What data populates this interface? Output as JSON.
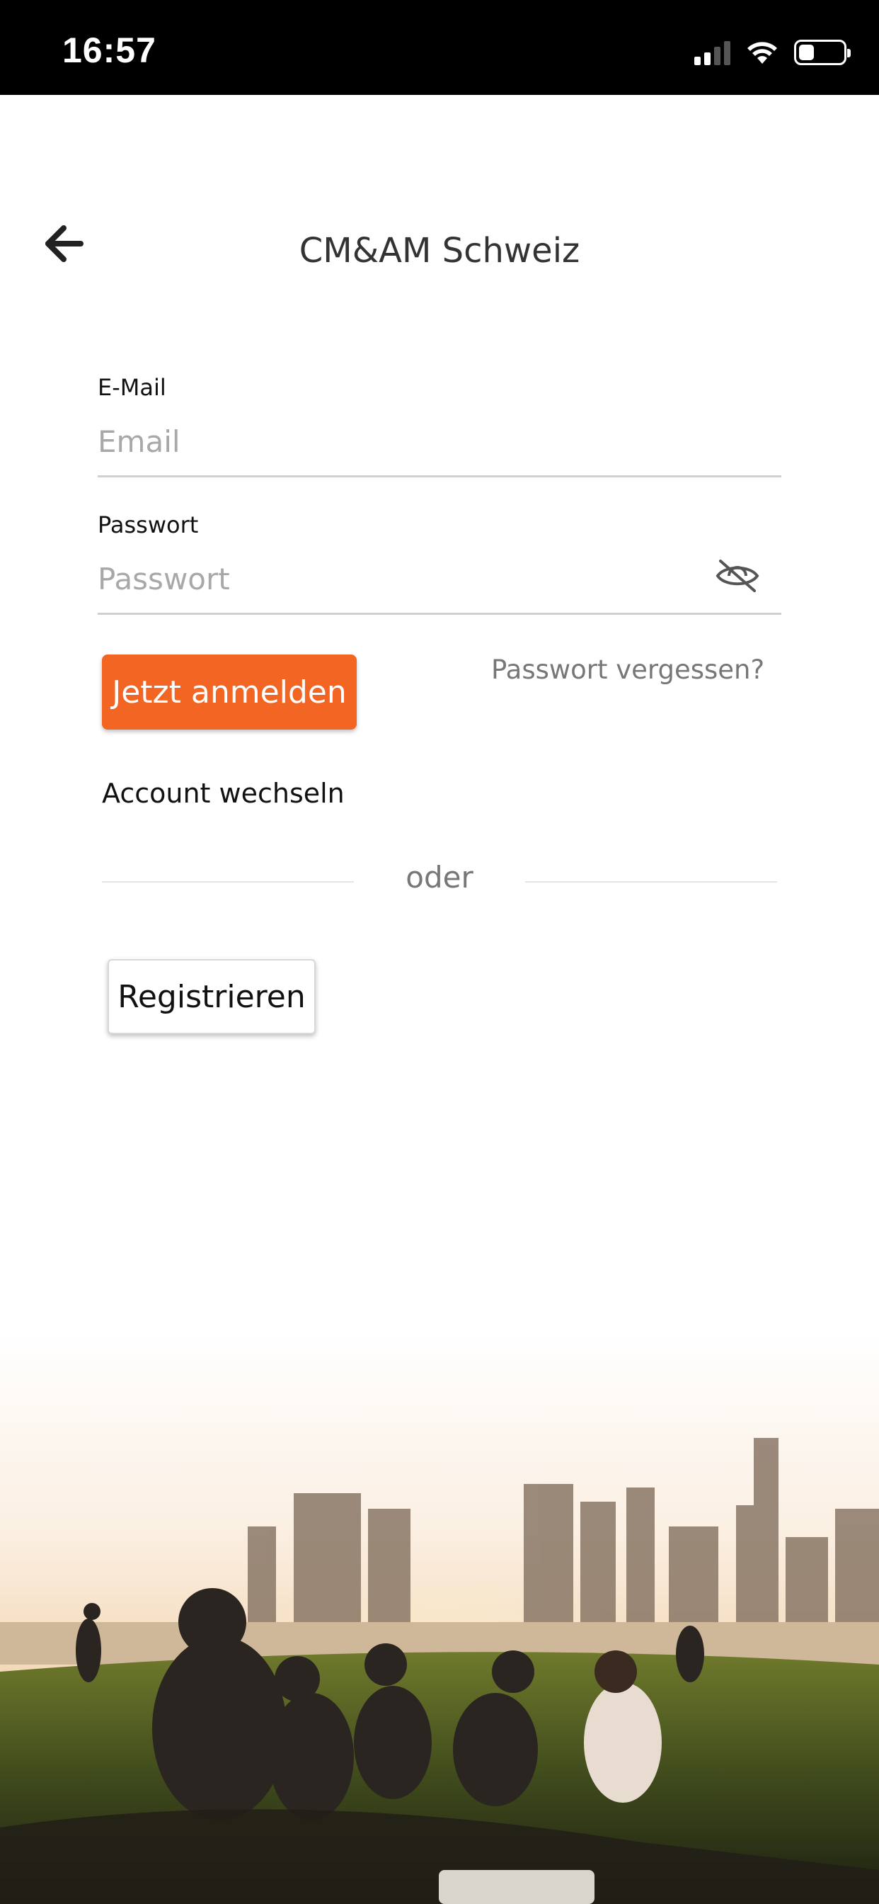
{
  "status_bar": {
    "time": "16:57",
    "signal_icon": "cellular-signal-icon",
    "wifi_icon": "wifi-icon",
    "battery_icon": "battery-icon",
    "battery_level_percent": 35
  },
  "header": {
    "back_icon": "arrow-left-icon",
    "title": "CM&AM Schweiz"
  },
  "form": {
    "email_label": "E-Mail",
    "email_placeholder": "Email",
    "email_value": "",
    "password_label": "Passwort",
    "password_placeholder": "Passwort",
    "password_value": "",
    "password_visibility_icon": "eye-off-icon"
  },
  "actions": {
    "login_label": "Jetzt anmelden",
    "forgot_password_label": "Passwort vergessen?",
    "switch_account_label": "Account wechseln",
    "divider_label": "oder",
    "register_label": "Registrieren"
  },
  "colors": {
    "accent": "#f26522",
    "status_bar_bg": "#000000",
    "background": "#ffffff"
  }
}
